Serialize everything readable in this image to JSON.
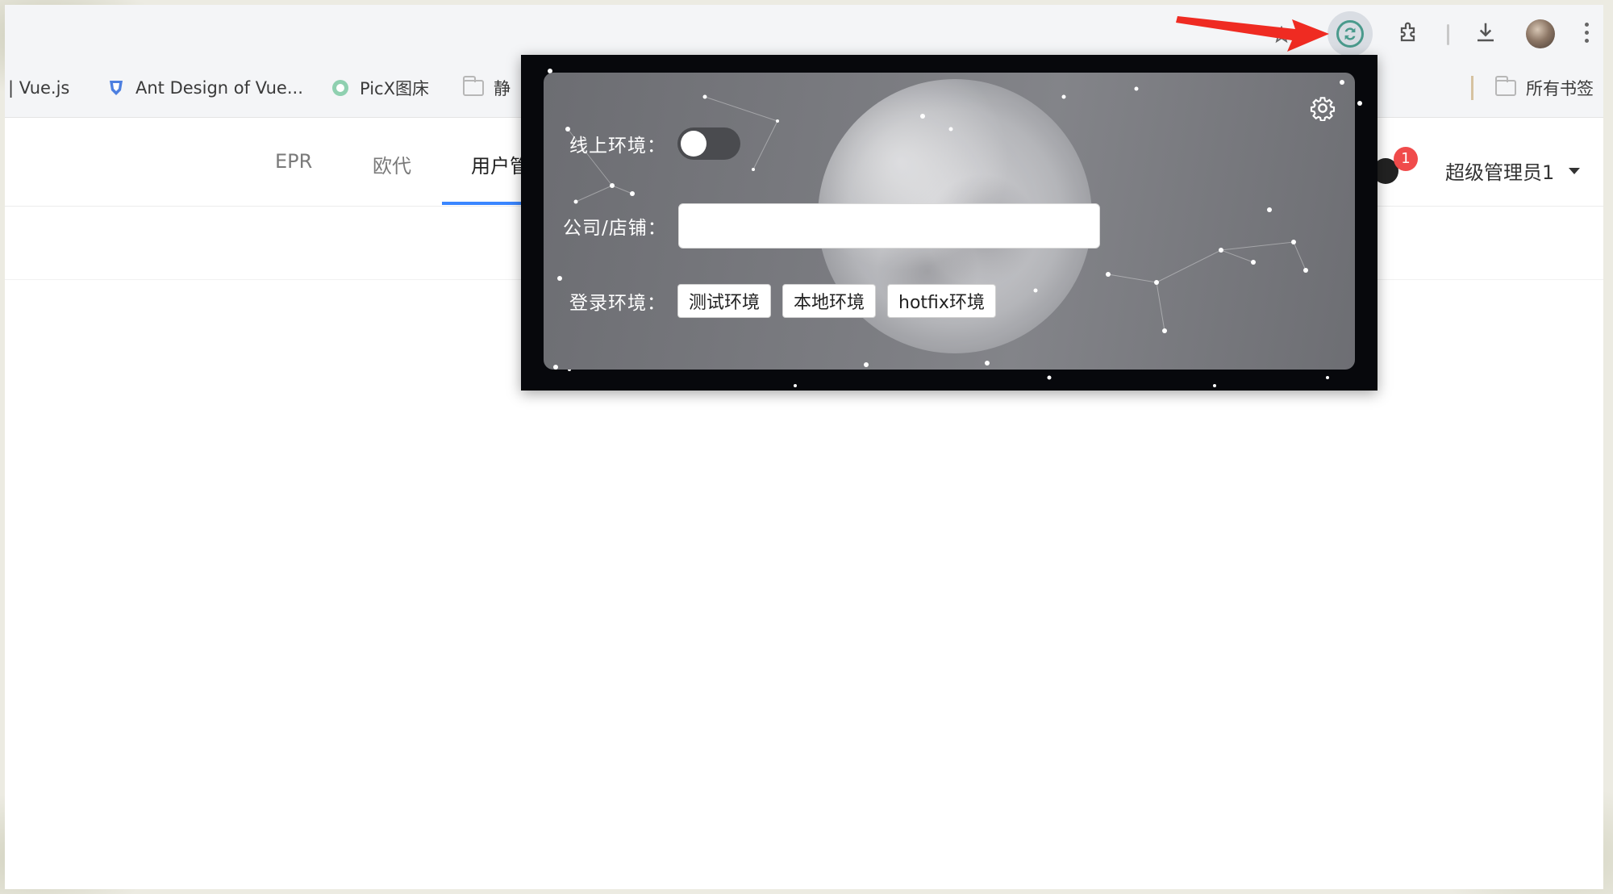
{
  "bookmarks": [
    {
      "label": "| Vue.js"
    },
    {
      "label": "Ant Design of Vue..."
    },
    {
      "label": "PicX图床"
    },
    {
      "label": "静"
    }
  ],
  "bookmarks_right": {
    "label": "所有书签"
  },
  "app": {
    "tabs": [
      {
        "label": "EPR"
      },
      {
        "label": "欧代"
      },
      {
        "label": "用户管"
      }
    ],
    "notification_count": "1",
    "user_name": "超级管理员1"
  },
  "popup": {
    "online_env_label": "线上环境：",
    "online_env_on": false,
    "company_label": "公司/店铺：",
    "company_value": "",
    "login_env_label": "登录环境：",
    "env_buttons": [
      {
        "label": "测试环境"
      },
      {
        "label": "本地环境"
      },
      {
        "label": "hotfix环境"
      }
    ]
  },
  "colors": {
    "accent_blue": "#3a86ff",
    "badge_red": "#f04b4b",
    "annotation_arrow": "#ef2b22",
    "extension_teal": "#4a9a8c"
  },
  "icons": {
    "toolbar": [
      "bookmark-star-icon",
      "extension-sync-icon",
      "puzzle-extensions-icon",
      "download-icon",
      "profile-avatar",
      "more-menu-icon"
    ],
    "popup": [
      "gear-icon"
    ]
  }
}
